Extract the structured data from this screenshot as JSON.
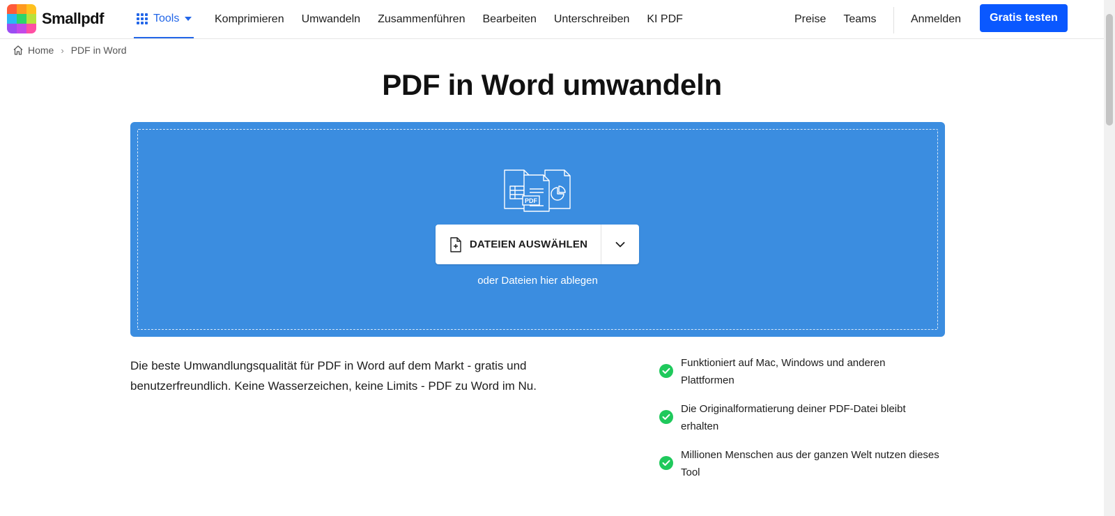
{
  "brand": {
    "name": "Smallpdf",
    "logo_colors": [
      "#ff5b3a",
      "#ff9a1f",
      "#ffc11e",
      "#2ab7f5",
      "#2dd46b",
      "#b8e23c",
      "#9b4df2",
      "#c34ae8",
      "#ff4fa3"
    ]
  },
  "nav": {
    "tools_label": "Tools",
    "items": [
      "Komprimieren",
      "Umwandeln",
      "Zusammenführen",
      "Bearbeiten",
      "Unterschreiben",
      "KI PDF"
    ],
    "right_items": [
      "Preise",
      "Teams"
    ],
    "login_label": "Anmelden",
    "cta_label": "Gratis testen",
    "cta_color": "#0a58ff",
    "accent_color": "#2266e8"
  },
  "breadcrumb": {
    "home": "Home",
    "separator": "›",
    "current": "PDF in Word"
  },
  "page_title": "PDF in Word umwandeln",
  "dropzone": {
    "background": "#3b8de0",
    "badge": "PDF",
    "choose_label": "DATEIEN AUSWÄHLEN",
    "drop_hint": "oder Dateien hier ablegen",
    "icons": [
      "file-plus-icon",
      "chevron-down-icon",
      "documents-illustration-icon"
    ]
  },
  "description_lines": [
    "Die beste Umwandlungsqualität für PDF in Word auf dem Markt - gratis und",
    "benutzerfreundlich. Keine Wasserzeichen, keine Limits - PDF zu Word im Nu."
  ],
  "features": [
    {
      "line1": "Funktioniert auf Mac, Windows und anderen",
      "line2": "Plattformen"
    },
    {
      "line1": "Die Originalformatierung deiner PDF-Datei bleibt",
      "line2": "erhalten"
    },
    {
      "line1": "Millionen Menschen aus der ganzen Welt nutzen dieses",
      "line2": "Tool"
    }
  ],
  "check_color": "#1fc95c"
}
